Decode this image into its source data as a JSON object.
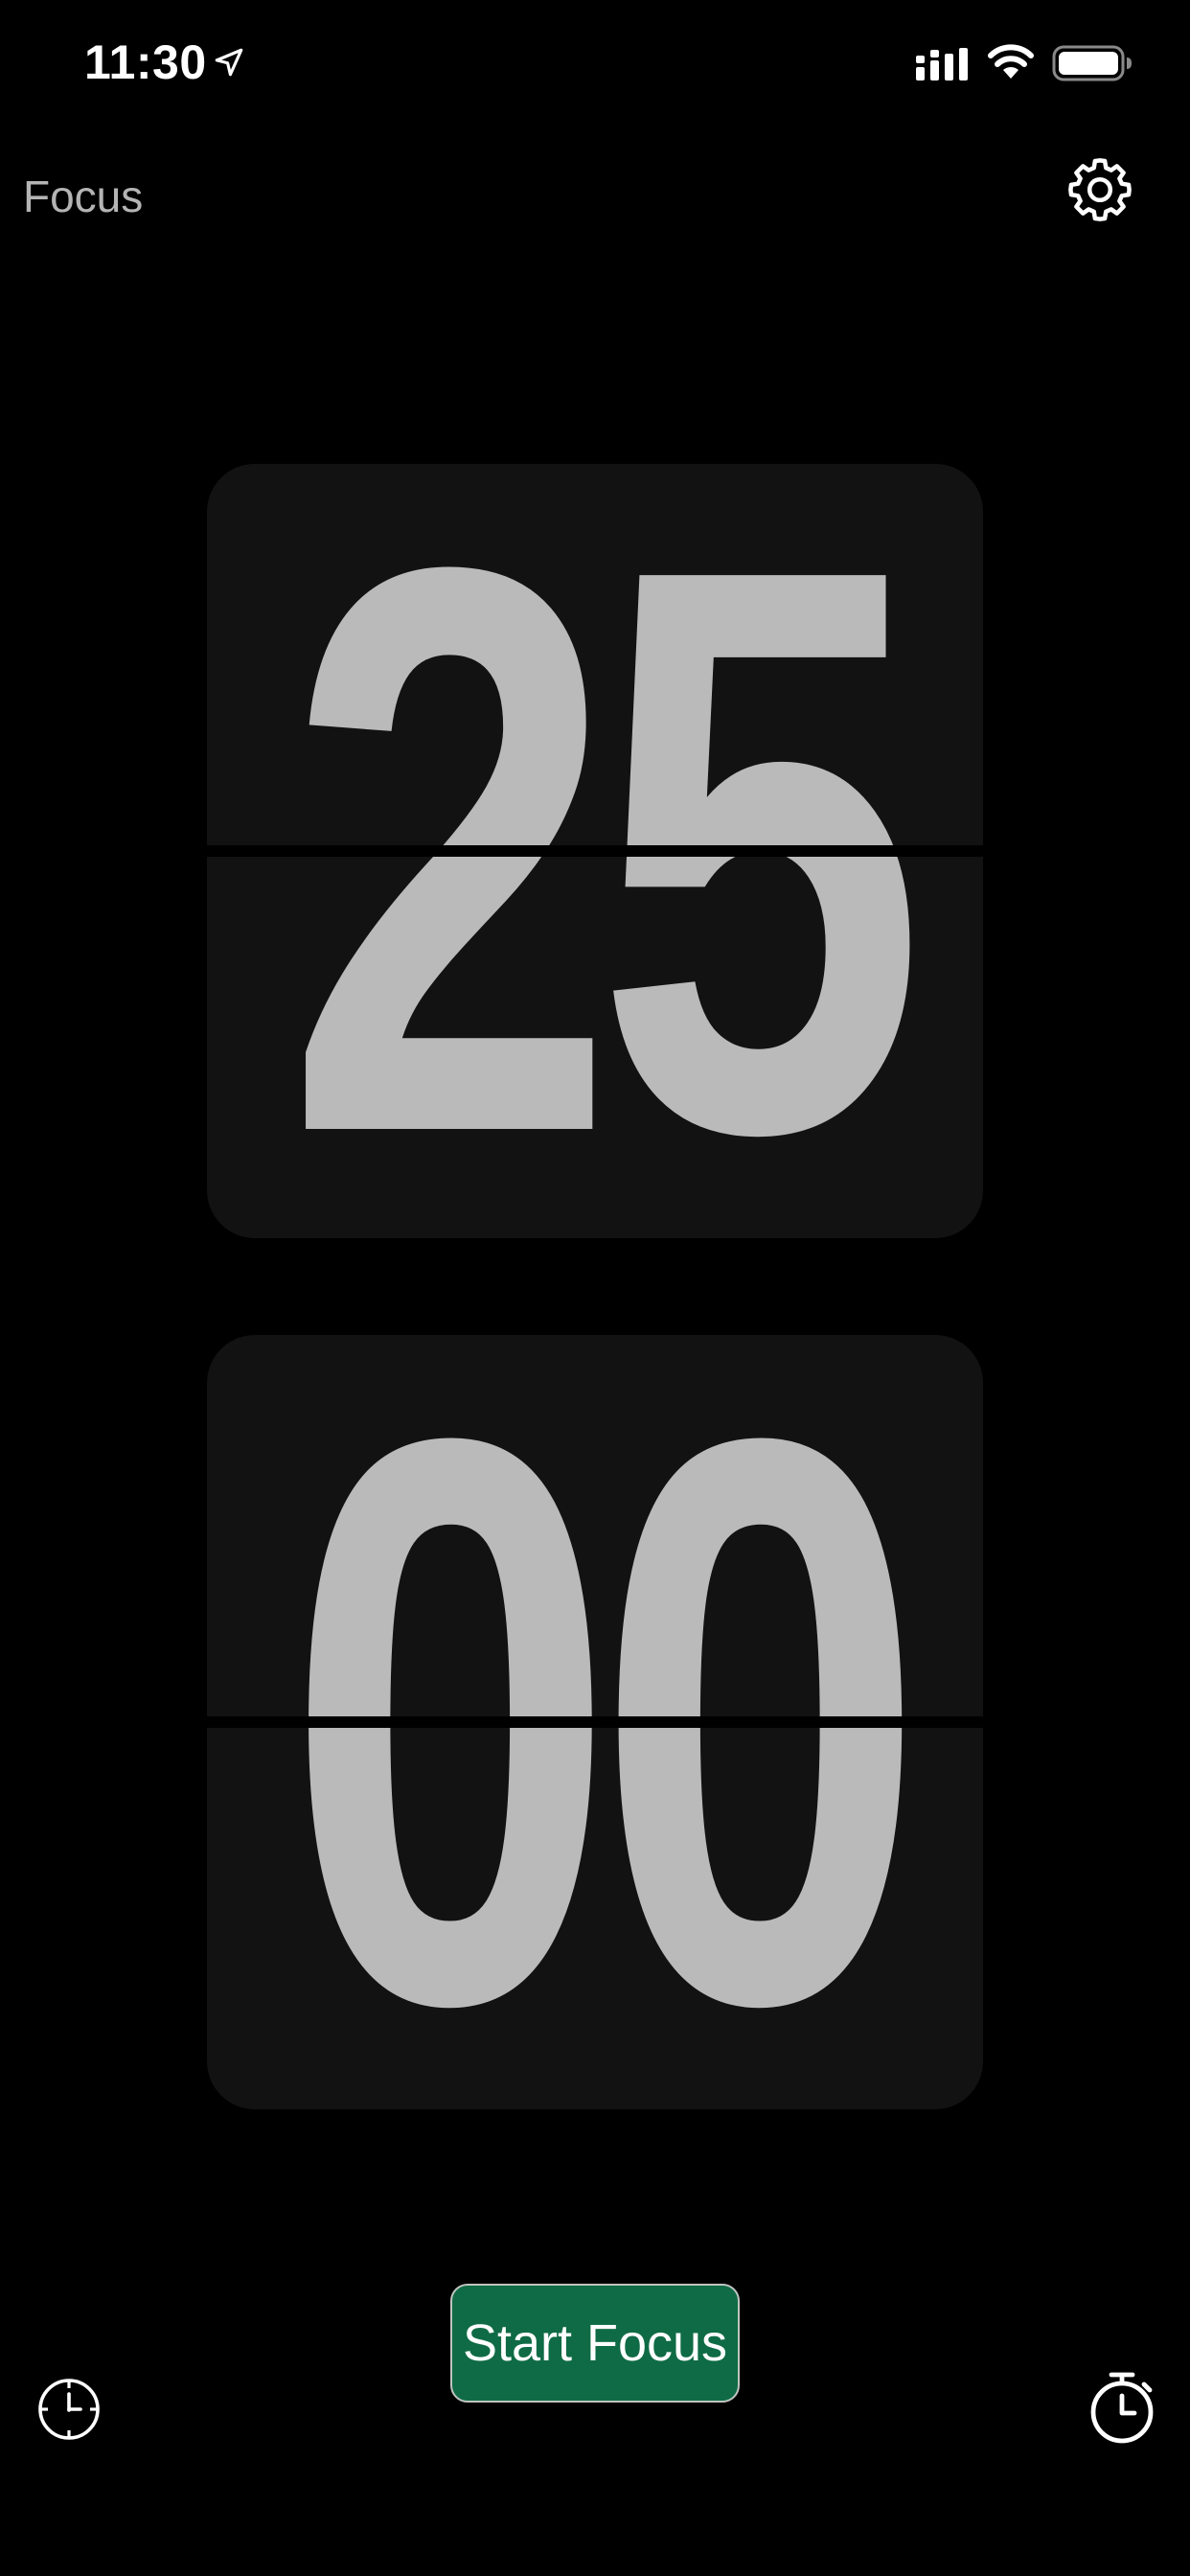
{
  "status_bar": {
    "time": "11:30",
    "icons": [
      "location-arrow-icon",
      "cellular-signal-icon",
      "wifi-icon",
      "battery-icon"
    ]
  },
  "nav": {
    "title": "Focus",
    "settings_icon": "gear-icon"
  },
  "timer": {
    "minutes": "25",
    "seconds": "00"
  },
  "actions": {
    "start_label": "Start Focus",
    "left_icon": "clock-icon",
    "right_icon": "stopwatch-icon"
  },
  "colors": {
    "background": "#000000",
    "card": "#121212",
    "digits": "#bababa",
    "accent_button": "#0f6b45",
    "title": "#b4b4b4"
  }
}
